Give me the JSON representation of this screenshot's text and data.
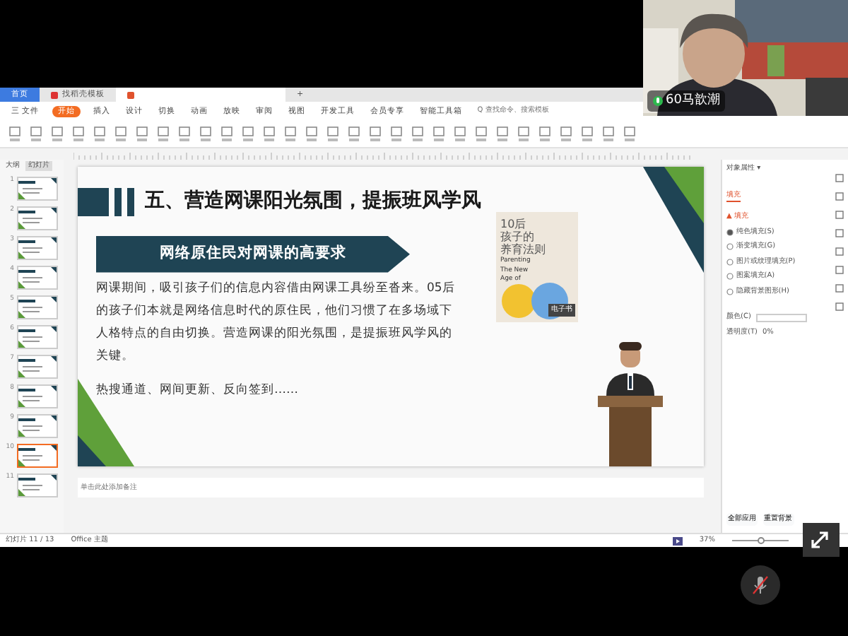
{
  "webcam": {
    "name": "60马歆潮"
  },
  "tabs": [
    {
      "label": "首页",
      "selected": false
    },
    {
      "label": "找稻壳模板",
      "selected": false
    },
    {
      "selected": true
    }
  ],
  "add_tab": "+",
  "menu": [
    {
      "label": "三 文件",
      "selected": false
    },
    {
      "label": "开始",
      "selected": true
    },
    {
      "label": "插入",
      "selected": false
    },
    {
      "label": "设计",
      "selected": false
    },
    {
      "label": "切换",
      "selected": false
    },
    {
      "label": "动画",
      "selected": false
    },
    {
      "label": "放映",
      "selected": false
    },
    {
      "label": "审阅",
      "selected": false
    },
    {
      "label": "视图",
      "selected": false
    },
    {
      "label": "开发工具",
      "selected": false
    },
    {
      "label": "会员专享",
      "selected": false
    },
    {
      "label": "智能工具箱",
      "selected": false
    }
  ],
  "search": {
    "placeholder": "Q 查找命令、搜索模板"
  },
  "panel_tabs": [
    {
      "label": "大纲",
      "selected": false
    },
    {
      "label": "幻灯片",
      "selected": true
    }
  ],
  "thumbnails": [
    {
      "number": "1",
      "selected": false
    },
    {
      "number": "2",
      "selected": false
    },
    {
      "number": "3",
      "selected": false
    },
    {
      "number": "4",
      "selected": false
    },
    {
      "number": "5",
      "selected": false
    },
    {
      "number": "6",
      "selected": false
    },
    {
      "number": "7",
      "selected": false
    },
    {
      "number": "8",
      "selected": false
    },
    {
      "number": "9",
      "selected": false
    },
    {
      "number": "10",
      "selected": true
    },
    {
      "number": "11",
      "selected": false
    }
  ],
  "slide": {
    "title": "五、营造网课阳光氛围，提振班风学风",
    "banner": "网络原住民对网课的高要求",
    "paragraph": "网课期间，吸引孩子们的信息内容借由网课工具纷至沓来。05后的孩子们本就是网络信息时代的原住民，他们习惯了在多场域下人格特点的自由切换。营造网课的阳光氛围，是提振班风学风的关键。",
    "list": "热搜通道、网间更新、反向签到……",
    "book": {
      "title_lines": [
        "10后",
        "孩子的",
        "养育法则"
      ],
      "subtitle_lines": [
        "Parenting",
        "The New",
        "Age of"
      ],
      "tag": "电子书"
    }
  },
  "properties": {
    "title": "对象属性 ▾",
    "tab": "填充",
    "section": "▲ 填充",
    "options": [
      {
        "label": "纯色填充(S)",
        "selected": true
      },
      {
        "label": "渐变填充(G)",
        "selected": false
      },
      {
        "label": "图片或纹理填充(P)",
        "selected": false
      },
      {
        "label": "图案填充(A)",
        "selected": false
      },
      {
        "label": "隐藏背景图形(H)",
        "selected": false
      }
    ],
    "color_label": "颜色(C)",
    "transparency_label": "透明度(T)",
    "transparency": "0%",
    "buttons": [
      "全部应用",
      "重置背景"
    ]
  },
  "notes": {
    "placeholder": "单击此处添加备注"
  },
  "status": {
    "slide": "幻灯片 11 / 13",
    "theme": "Office 主题",
    "zoom": "37%",
    "zoom_slider": {
      "level": 0.5
    }
  }
}
